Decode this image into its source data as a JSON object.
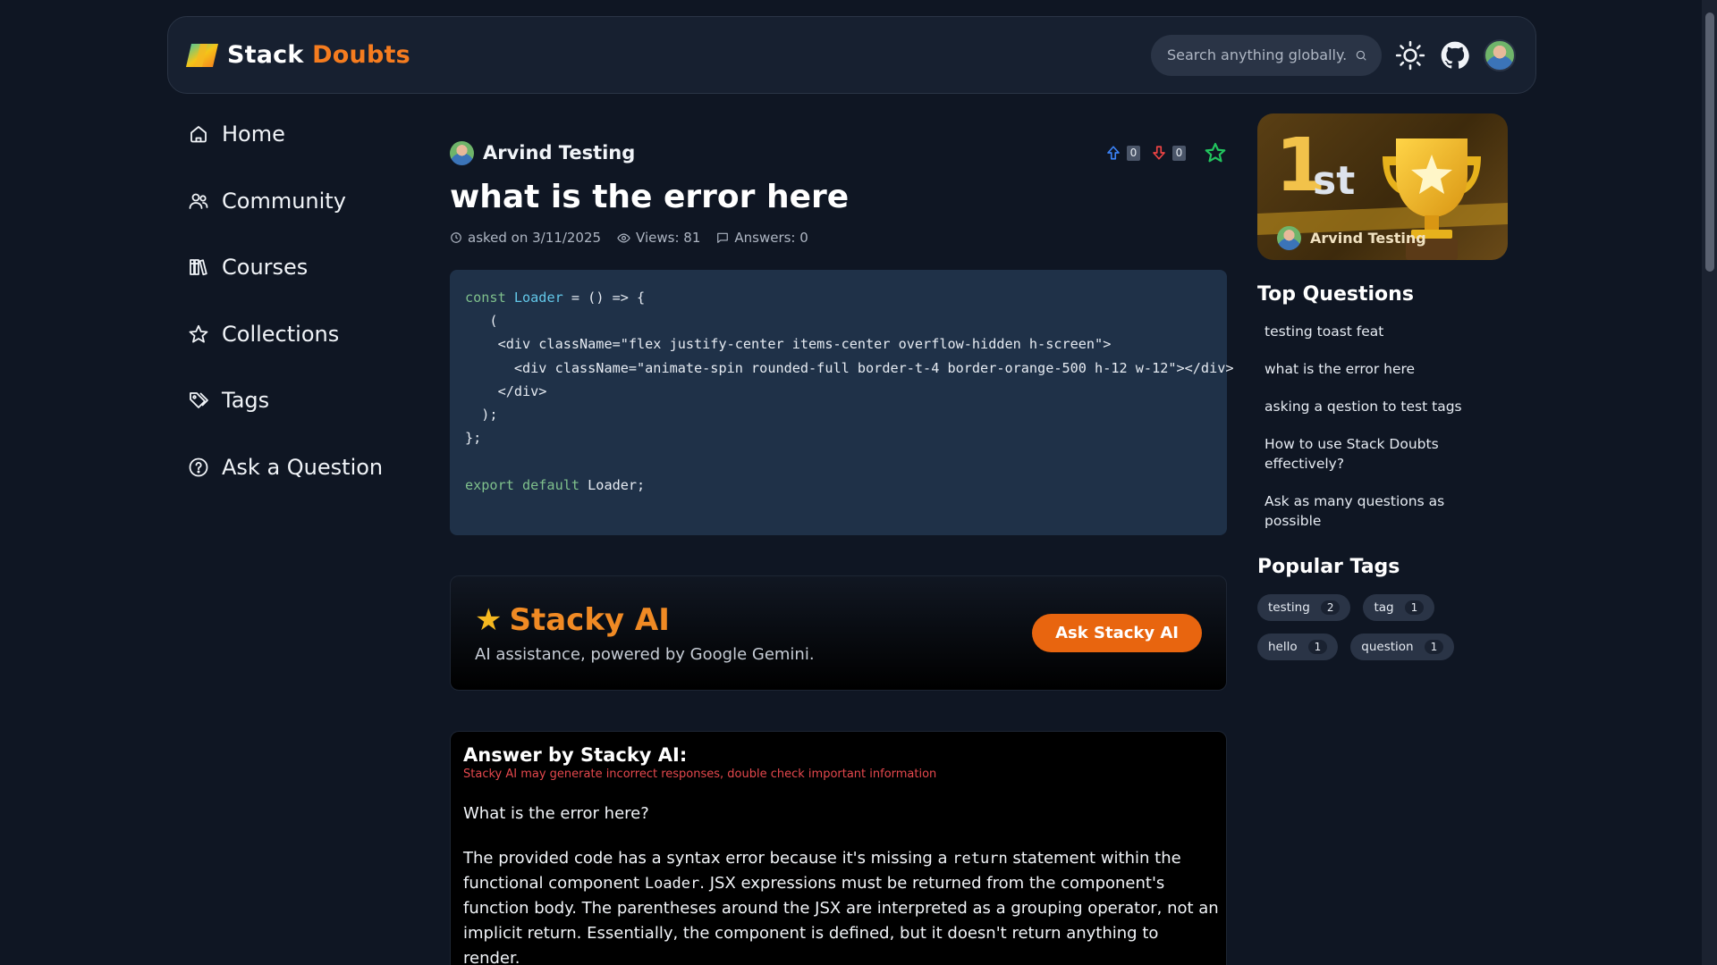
{
  "header": {
    "logo_part1": "Stack",
    "logo_part2": "Doubts",
    "search_placeholder": "Search anything globally..."
  },
  "sidebar": {
    "items": [
      {
        "label": "Home",
        "icon": "home-icon"
      },
      {
        "label": "Community",
        "icon": "users-icon"
      },
      {
        "label": "Courses",
        "icon": "books-icon"
      },
      {
        "label": "Collections",
        "icon": "star-icon"
      },
      {
        "label": "Tags",
        "icon": "tag-icon"
      },
      {
        "label": "Ask a Question",
        "icon": "question-icon"
      }
    ]
  },
  "question": {
    "author": "Arvind Testing",
    "title": "what is the error here",
    "asked": "asked on 3/11/2025",
    "views": "Views: 81",
    "answers": "Answers: 0",
    "upvotes": "0",
    "downvotes": "0"
  },
  "stacky": {
    "title": "Stacky AI",
    "subtitle": "AI assistance, powered by Google Gemini.",
    "button": "Ask Stacky AI"
  },
  "answer": {
    "title": "Answer by Stacky AI:",
    "warning": "Stacky AI may generate incorrect responses, double check important information",
    "question": "What is the error here?",
    "p1_a": "The provided code has a syntax error because it's missing a ",
    "p1_code1": "return",
    "p1_b": " statement within the functional component ",
    "p1_code2": "Loader",
    "p1_c": ".  JSX expressions must be returned from the component's function body.  The parentheses around the JSX are interpreted as a grouping operator, not an implicit return.  Essentially, the component is defined, but it doesn't return anything to render."
  },
  "rail": {
    "rank_number": "1",
    "rank_suffix": "st",
    "top_user": "Arvind Testing",
    "top_questions_heading": "Top Questions",
    "top_questions": [
      "testing toast feat",
      "what is the error here",
      "asking a qestion to test tags",
      "How to use Stack Doubts effectively?",
      "Ask as many questions as possible"
    ],
    "popular_tags_heading": "Popular Tags",
    "tags": [
      {
        "name": "testing",
        "count": "2"
      },
      {
        "name": "tag",
        "count": "1"
      },
      {
        "name": "hello",
        "count": "1"
      },
      {
        "name": "question",
        "count": "1"
      }
    ]
  },
  "colors": {
    "accent": "#f57c1f",
    "background": "#0f1623",
    "code_bg": "#1f3148"
  }
}
